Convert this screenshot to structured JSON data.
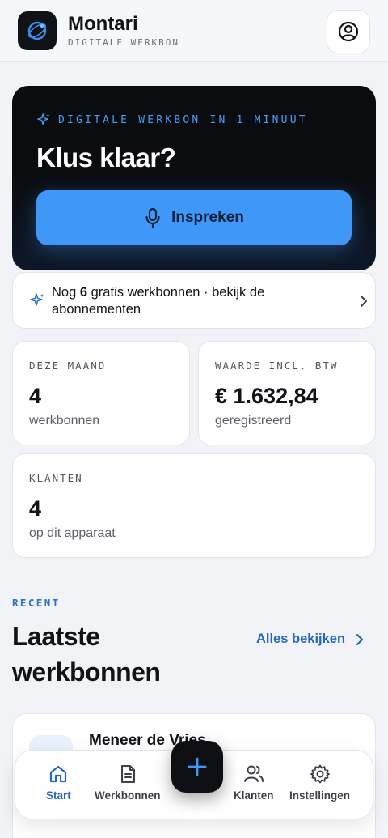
{
  "app": {
    "name": "Montari",
    "subtitle": "DIGITALE WERKBON"
  },
  "hero": {
    "kicker": "DIGITALE WERKBON IN 1 MINUUT",
    "title": "Klus klaar?",
    "button_label": "Inspreken"
  },
  "plan_banner": {
    "prefix": "Nog ",
    "count": "6",
    "suffix": " gratis werkbonnen · bekijk de abonnementen"
  },
  "stats": {
    "month": {
      "label": "DEZE MAAND",
      "value": "4",
      "sub": "werkbonnen"
    },
    "value": {
      "label": "WAARDE INCL. BTW",
      "value": "€ 1.632,84",
      "sub": "geregistreerd"
    },
    "clients": {
      "label": "KLANTEN",
      "value": "4",
      "sub": "op dit apparaat"
    }
  },
  "recent": {
    "kicker": "RECENT",
    "title": "Laatste werkbonnen",
    "see_all": "Alles bekijken",
    "items": [
      {
        "name": "Meneer de Vries"
      }
    ]
  },
  "nav": {
    "items": [
      {
        "label": "Start",
        "icon": "home-icon",
        "active": true
      },
      {
        "label": "Werkbonnen",
        "icon": "document-icon",
        "active": false
      },
      {
        "label": "Klanten",
        "icon": "users-icon",
        "active": false
      },
      {
        "label": "Instellingen",
        "icon": "gear-icon",
        "active": false
      }
    ]
  },
  "colors": {
    "accent": "#3f98f8",
    "link": "#2368c0",
    "hero_bg": "#0b0c0f",
    "background": "#f2f3f6"
  }
}
